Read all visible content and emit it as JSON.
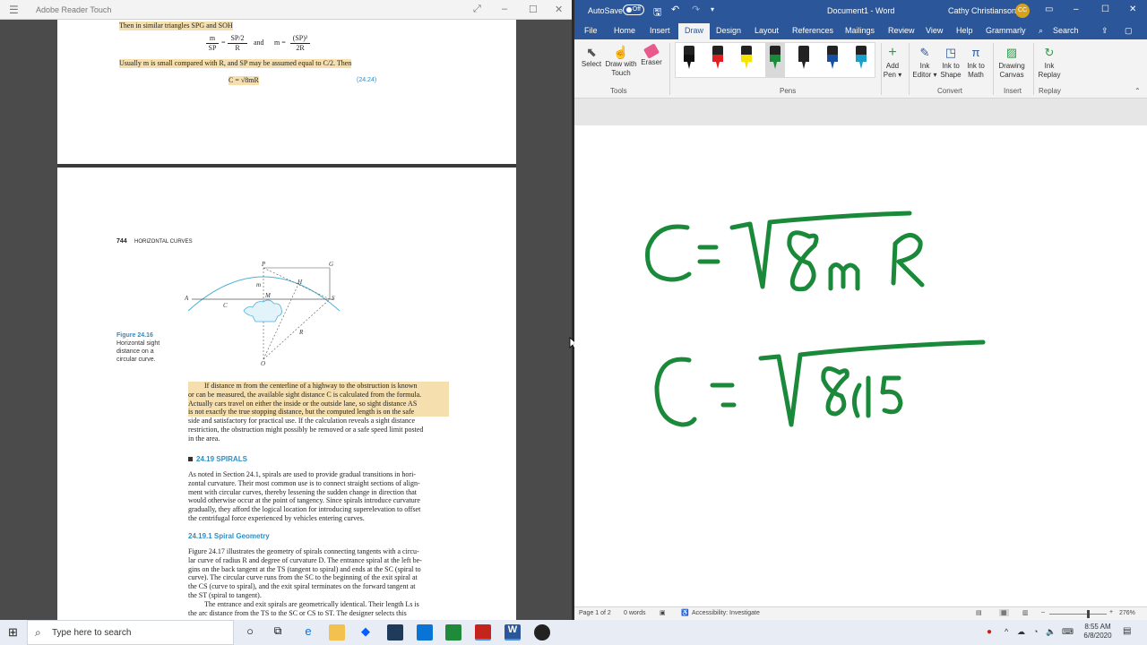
{
  "reader": {
    "app_title": "Adobe Reader Touch",
    "page1": {
      "line1": "Then in similar triangles SPG and SOH",
      "formula_m1_num": "m",
      "formula_m1_den": "SP",
      "formula_m1_rhs_num": "SP/2",
      "formula_m1_rhs_den": "R",
      "formula_and": "and",
      "formula_m2_lhs": "m =",
      "formula_m2_num": "(SP)²",
      "formula_m2_den": "2R",
      "line2": "Usually m is small compared with R, and SP may be assumed equal to C/2. Then",
      "formula_c": "C = √8mR",
      "formula_no": "(24.24)"
    },
    "page2": {
      "running_head_num": "744",
      "running_head": "HORIZONTAL CURVES",
      "figure_labels": {
        "P": "P",
        "G": "G",
        "A": "A",
        "S": "S",
        "m": "m",
        "M": "M",
        "H": "H",
        "C": "C",
        "R": "R",
        "O": "O"
      },
      "figure_caption_title": "Figure 24.16",
      "figure_caption_l1": "Horizontal sight",
      "figure_caption_l2": "distance on a",
      "figure_caption_l3": "circular curve.",
      "para1": [
        "If distance m from the centerline of a highway to the obstruction is known",
        "or can be measured, the available sight distance C is calculated from the formula.",
        "Actually cars travel on either the inside or the outside lane, so sight distance AS",
        "is not exactly the true stopping distance, but the computed length is on the safe",
        "side and satisfactory for practical use. If the calculation reveals a sight distance",
        "restriction, the obstruction might possibly be removed or a safe speed limit posted",
        "in the area."
      ],
      "section_title": "24.19 SPIRALS",
      "para2": [
        "As noted in Section 24.1, spirals are used to provide gradual transitions in hori-",
        "zontal curvature. Their most common use is to connect straight sections of align-",
        "ment with circular curves, thereby lessening the sudden change in direction that",
        "would otherwise occur at the point of tangency. Since spirals introduce curvature",
        "gradually, they afford the logical location for introducing superelevation to offset",
        "the centrifugal force experienced by vehicles entering curves."
      ],
      "subsection_title": "24.19.1 Spiral Geometry",
      "para3": [
        "Figure 24.17 illustrates the geometry of spirals connecting tangents with a circu-",
        "lar curve of radius R and degree of curvature D. The entrance spiral at the left be-",
        "gins on the back tangent at the TS (tangent to spiral) and ends at the SC (spiral to",
        "curve). The circular curve runs from the SC to the beginning of the exit spiral at",
        "the CS (curve to spiral), and the exit spiral terminates on the forward tangent at",
        "the ST (spiral to tangent).",
        "The entrance and exit spirals are geometrically identical. Their length Ls is",
        "the arc distance from the TS to the SC or CS to ST. The designer selects this"
      ]
    }
  },
  "word": {
    "autosave_label": "AutoSave",
    "autosave_state": "Off",
    "doc_title": "Document1 - Word",
    "user_name": "Cathy Christianson",
    "user_initials": "CC",
    "tabs": [
      "File",
      "Home",
      "Insert",
      "Draw",
      "Design",
      "Layout",
      "References",
      "Mailings",
      "Review",
      "View",
      "Help",
      "Grammarly"
    ],
    "active_tab": "Draw",
    "search_label": "Search",
    "ribbon": {
      "select": "Select",
      "draw_touch_l1": "Draw with",
      "draw_touch_l2": "Touch",
      "eraser": "Eraser",
      "group_tools": "Tools",
      "group_pens": "Pens",
      "add_pen_l1": "Add",
      "add_pen_l2": "Pen ▾",
      "ink_editor_l1": "Ink",
      "ink_editor_l2": "Editor ▾",
      "ink_shape_l1": "Ink to",
      "ink_shape_l2": "Shape",
      "ink_math_l1": "Ink to",
      "ink_math_l2": "Math",
      "group_convert": "Convert",
      "drawing_canvas_l1": "Drawing",
      "drawing_canvas_l2": "Canvas",
      "group_insert": "Insert",
      "ink_replay_l1": "Ink",
      "ink_replay_l2": "Replay",
      "group_replay": "Replay"
    },
    "pens": [
      "#111111",
      "#e02020",
      "#f5e400",
      "#1a8a3a",
      "#222222",
      "#1a4fa0",
      "#1aa0c8"
    ],
    "ink_color": "#1a8a3a",
    "status": {
      "page": "Page 1 of 2",
      "words": "0 words",
      "accessibility": "Accessibility: Investigate",
      "zoom": "276%"
    }
  },
  "taskbar": {
    "search_placeholder": "Type here to search",
    "time": "8:55 AM",
    "date": "6/8/2020"
  }
}
